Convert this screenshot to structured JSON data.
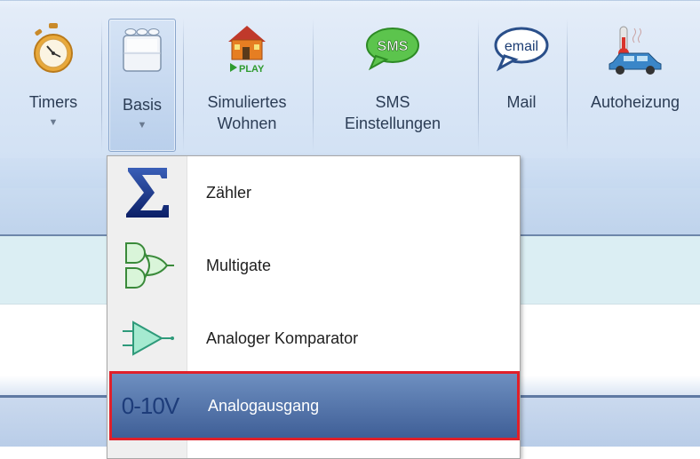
{
  "ribbon": {
    "buttons": [
      {
        "id": "timers",
        "label": "Timers",
        "has_dropdown": true,
        "icon": "stopwatch-icon"
      },
      {
        "id": "basis",
        "label": "Basis",
        "has_dropdown": true,
        "icon": "building-blocks-icon",
        "active": true
      },
      {
        "id": "simuliertes",
        "label_line1": "Simuliertes",
        "label_line2": "Wohnen",
        "icon": "house-play-icon",
        "play_text": "PLAY"
      },
      {
        "id": "sms",
        "label_line1": "SMS",
        "label_line2": "Einstellungen",
        "icon": "sms-bubble-icon",
        "icon_text": "SMS"
      },
      {
        "id": "mail",
        "label": "Mail",
        "icon": "email-bubble-icon",
        "icon_text": "email"
      },
      {
        "id": "autoheizung",
        "label": "Autoheizung",
        "icon": "heated-car-icon"
      }
    ]
  },
  "menu": {
    "items": [
      {
        "label": "Zähler",
        "icon": "sigma-icon"
      },
      {
        "label": "Multigate",
        "icon": "logic-gates-icon"
      },
      {
        "label": "Analoger Komparator",
        "icon": "comparator-icon"
      },
      {
        "label": "Analogausgang",
        "icon": "analog-output-icon",
        "icon_text": "0-10V",
        "selected": true
      }
    ]
  },
  "colors": {
    "highlight_border": "#e0202a",
    "selected_bg": "#4a6aa0",
    "ribbon_bg": "#d9e6f6"
  }
}
